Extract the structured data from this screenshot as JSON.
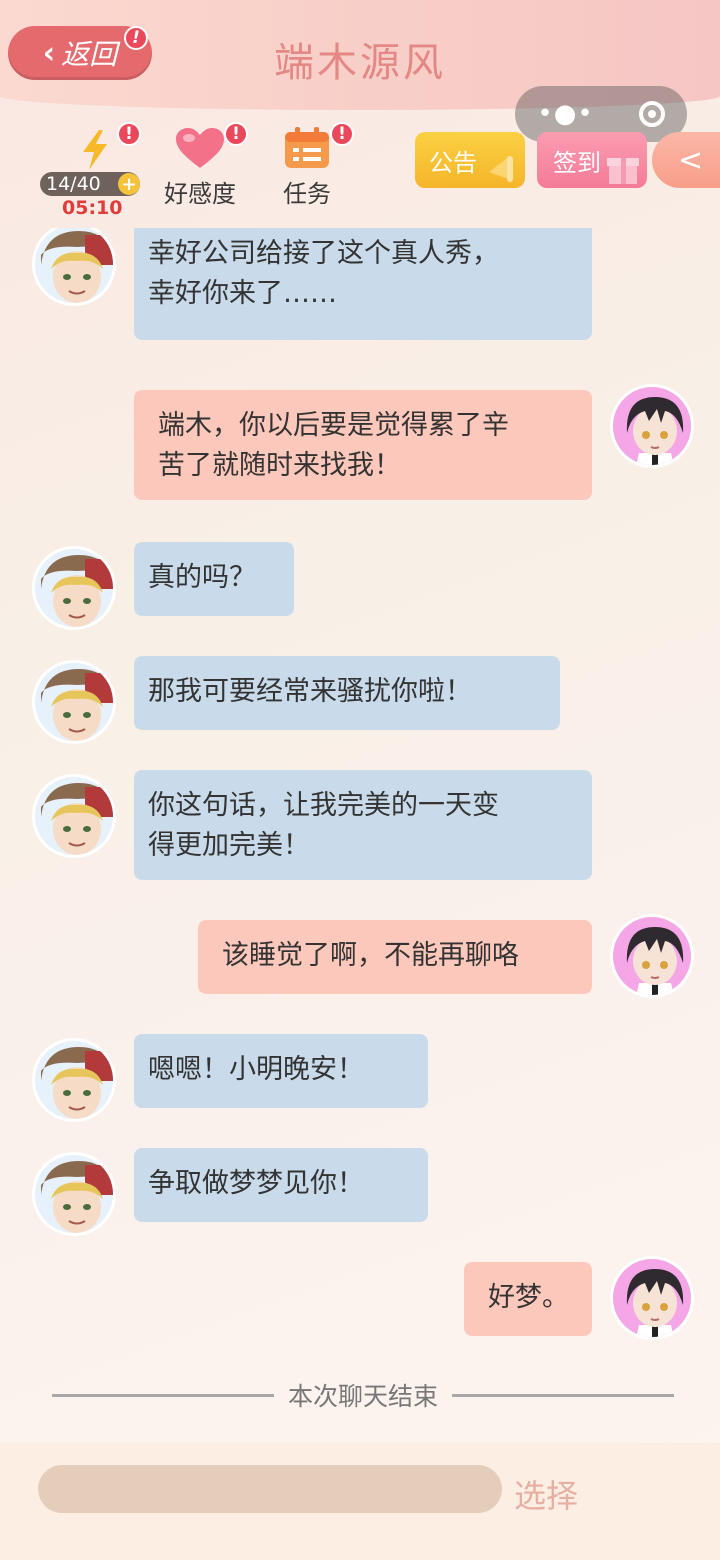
{
  "header": {
    "back_label": "返回",
    "back_icon": "chevron-left-icon",
    "title": "端木源风",
    "alert_mark": "!"
  },
  "status": {
    "energy": "14/40",
    "energy_plus": "+",
    "timer": "05:10",
    "favor_label": "好感度",
    "task_label": "任务"
  },
  "actions": {
    "notice_label": "公告",
    "sign_label": "签到",
    "collapse_icon": "<"
  },
  "messages": [
    {
      "side": "left",
      "text_lines": [
        "幸好公司给接了这个真人秀，",
        "幸好你来了……"
      ]
    },
    {
      "side": "right",
      "text_lines": [
        "端木，你以后要是觉得累了辛",
        "苦了就随时来找我！"
      ]
    },
    {
      "side": "left",
      "text_lines": [
        "真的吗？"
      ]
    },
    {
      "side": "left",
      "text_lines": [
        "那我可要经常来骚扰你啦！"
      ]
    },
    {
      "side": "left",
      "text_lines": [
        "你这句话，让我完美的一天变",
        "得更加完美！"
      ]
    },
    {
      "side": "right",
      "text_lines": [
        "该睡觉了啊，不能再聊咯"
      ]
    },
    {
      "side": "left",
      "text_lines": [
        "嗯嗯！小明晚安！"
      ]
    },
    {
      "side": "left",
      "text_lines": [
        "争取做梦梦见你！"
      ]
    },
    {
      "side": "right",
      "text_lines": [
        "好梦。"
      ]
    }
  ],
  "end_text": "本次聊天结束",
  "bottom": {
    "input_placeholder": "",
    "choose_label": "选择"
  },
  "colors": {
    "accent": "#e56a6e",
    "left_bubble": "#c9dbea",
    "right_bubble": "#fdc8bc",
    "title": "#e48886"
  }
}
